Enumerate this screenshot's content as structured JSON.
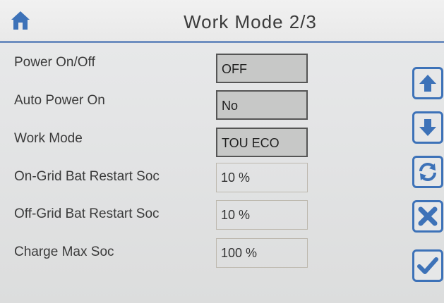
{
  "header": {
    "title": "Work Mode 2/3"
  },
  "settings": [
    {
      "label": "Power On/Off",
      "value": "OFF"
    },
    {
      "label": "Auto Power On",
      "value": "No"
    },
    {
      "label": "Work Mode",
      "value": "TOU ECO"
    },
    {
      "label": "On-Grid Bat Restart Soc",
      "value": "10 %"
    },
    {
      "label": "Off-Grid Bat Restart Soc",
      "value": "10 %"
    },
    {
      "label": "Charge Max Soc",
      "value": "100 %"
    }
  ],
  "side_buttons": [
    {
      "icon": "arrow-up-icon"
    },
    {
      "icon": "arrow-down-icon"
    },
    {
      "icon": "refresh-icon"
    },
    {
      "icon": "close-icon"
    },
    {
      "icon": "check-icon"
    }
  ],
  "colors": {
    "accent": "#3d72b8",
    "header_line": "#6f8fc0",
    "selected_field": "#c7c8c7"
  }
}
